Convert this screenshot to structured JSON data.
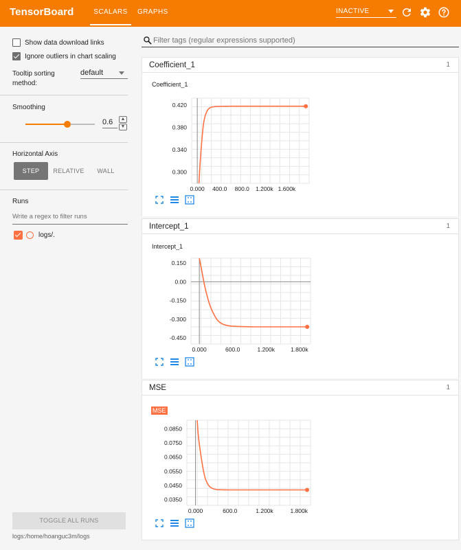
{
  "header": {
    "brand": "TensorBoard",
    "tabs": [
      {
        "label": "SCALARS",
        "active": true
      },
      {
        "label": "GRAPHS",
        "active": false
      }
    ],
    "run_selector": "INACTIVE",
    "icons": [
      "refresh-icon",
      "settings-gear-icon",
      "help-icon"
    ]
  },
  "sidebar": {
    "show_download_links": {
      "label": "Show data download links",
      "checked": false
    },
    "ignore_outliers": {
      "label": "Ignore outliers in chart scaling",
      "checked": true
    },
    "tooltip_sort_label_1": "Tooltip sorting",
    "tooltip_sort_label_2": "method:",
    "tooltip_sort_value": "default",
    "smoothing_label": "Smoothing",
    "smoothing_value": "0.6",
    "smoothing_fraction": 0.6,
    "horizontal_axis_label": "Horizontal Axis",
    "axis_buttons": [
      {
        "label": "STEP",
        "active": true
      },
      {
        "label": "RELATIVE",
        "active": false
      },
      {
        "label": "WALL",
        "active": false
      }
    ],
    "runs_label": "Runs",
    "runs_filter_placeholder": "Write a regex to filter runs",
    "runs": [
      {
        "label": "logs/.",
        "checked": true,
        "color": "#ff7043"
      }
    ],
    "toggle_all_runs": "TOGGLE ALL RUNS",
    "logdir": "logs:/home/hoanguc3m/logs"
  },
  "main": {
    "tag_filter_placeholder": "Filter tags (regular expressions supported)",
    "categories": [
      {
        "name": "Coefficient_1",
        "count": "1"
      },
      {
        "name": "Intercept_1",
        "count": "1"
      },
      {
        "name": "MSE",
        "count": "1"
      }
    ]
  },
  "chart_data": [
    {
      "type": "line",
      "title": "Coefficient_1",
      "xlabel": "",
      "ylabel": "",
      "xlim": [
        -100,
        2000
      ],
      "ylim": [
        0.28,
        0.432
      ],
      "xticks": [
        0,
        400,
        800,
        1200,
        1600
      ],
      "xtick_labels": [
        "0.000",
        "400.0",
        "800.0",
        "1.200k",
        "1.600k"
      ],
      "yticks": [
        0.3,
        0.34,
        0.38,
        0.42
      ],
      "ytick_labels": [
        "0.300",
        "0.340",
        "0.380",
        "0.420"
      ],
      "grid": true,
      "color": "#ff7043",
      "series": [
        {
          "x": [
            30,
            50,
            80,
            110,
            140,
            180,
            220,
            280,
            350,
            450,
            600,
            800,
            1100,
            1500,
            1940
          ],
          "y": [
            0.28,
            0.315,
            0.355,
            0.385,
            0.4,
            0.41,
            0.4145,
            0.4165,
            0.4172,
            0.4175,
            0.4176,
            0.4176,
            0.4176,
            0.4176,
            0.4176
          ]
        }
      ]
    },
    {
      "type": "line",
      "title": "Intercept_1",
      "xlabel": "",
      "ylabel": "",
      "xlim": [
        -150,
        2000
      ],
      "ylim": [
        -0.5,
        0.19
      ],
      "xticks": [
        0,
        600,
        1200,
        1800
      ],
      "xtick_labels": [
        "0.000",
        "600.0",
        "1.200k",
        "1.800k"
      ],
      "yticks": [
        0.15,
        0.0,
        -0.15,
        -0.3,
        -0.45
      ],
      "ytick_labels": [
        "0.150",
        "0.00",
        "-0.150",
        "-0.300",
        "-0.450"
      ],
      "grid": true,
      "color": "#ff7043",
      "series": [
        {
          "x": [
            0,
            30,
            60,
            100,
            150,
            200,
            260,
            330,
            420,
            550,
            750,
            1000,
            1400,
            1940
          ],
          "y": [
            0.19,
            0.12,
            0.05,
            -0.04,
            -0.13,
            -0.2,
            -0.26,
            -0.31,
            -0.34,
            -0.355,
            -0.36,
            -0.362,
            -0.362,
            -0.362
          ]
        }
      ]
    },
    {
      "type": "line",
      "title": "MSE",
      "xlabel": "",
      "ylabel": "",
      "xlim": [
        -150,
        2000
      ],
      "ylim": [
        0.031,
        0.091
      ],
      "xticks": [
        0,
        600,
        1200,
        1800
      ],
      "xtick_labels": [
        "0.000",
        "600.0",
        "1.200k",
        "1.800k"
      ],
      "yticks": [
        0.085,
        0.075,
        0.065,
        0.055,
        0.045,
        0.035
      ],
      "ytick_labels": [
        "0.0850",
        "0.0750",
        "0.0650",
        "0.0550",
        "0.0450",
        "0.0350"
      ],
      "grid": true,
      "color": "#ff7043",
      "series": [
        {
          "x": [
            30,
            50,
            80,
            110,
            140,
            170,
            200,
            240,
            290,
            360,
            450,
            600,
            900,
            1300,
            1940
          ],
          "y": [
            0.091,
            0.08,
            0.07,
            0.062,
            0.055,
            0.05,
            0.047,
            0.0445,
            0.043,
            0.0422,
            0.042,
            0.0419,
            0.0419,
            0.0419,
            0.0419
          ]
        }
      ]
    }
  ]
}
